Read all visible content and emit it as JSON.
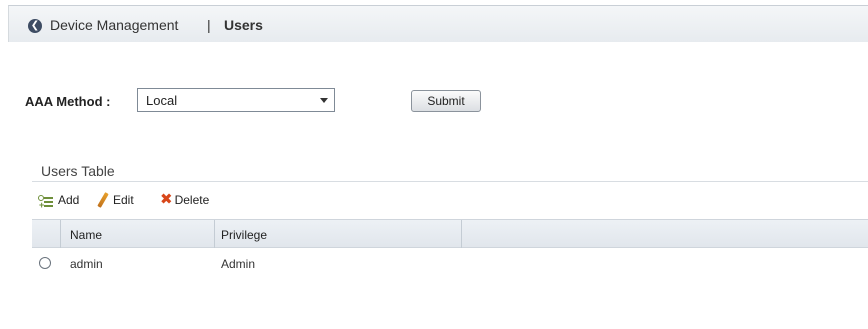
{
  "breadcrumb": {
    "parent": "Device Management",
    "separator": "|",
    "current": "Users"
  },
  "aaa": {
    "label": "AAA Method :",
    "selected": "Local",
    "submit_label": "Submit"
  },
  "users_table": {
    "title": "Users Table",
    "toolbar": {
      "add_label": "Add",
      "edit_label": "Edit",
      "delete_label": "Delete"
    },
    "columns": [
      "Name",
      "Privilege"
    ],
    "rows": [
      {
        "name": "admin",
        "privilege": "Admin"
      }
    ]
  },
  "icons": [
    "back-arrow-icon",
    "add-user-icon",
    "pencil-icon",
    "delete-x-icon",
    "dropdown-arrow-icon",
    "radio-icon"
  ],
  "colors": {
    "delete_red": "#d8471a",
    "edit_orange": "#e8a12c",
    "add_green": "#6e8f3a",
    "back_button": "#3d4c63"
  }
}
